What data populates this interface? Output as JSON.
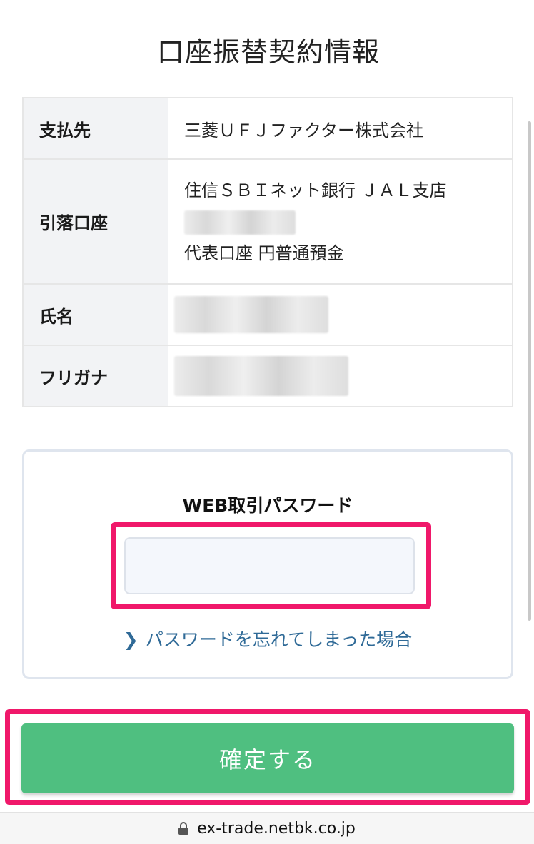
{
  "page": {
    "title": "口座振替契約情報"
  },
  "info_table": {
    "rows": [
      {
        "label": "支払先",
        "value": "三菱ＵＦＪファクター株式会社"
      },
      {
        "label": "引落口座",
        "bank": "住信ＳＢＩネット銀行 ＪＡＬ支店",
        "account_type": "代表口座 円普通預金"
      },
      {
        "label": "氏名"
      },
      {
        "label": "フリガナ"
      }
    ]
  },
  "password_section": {
    "label": "WEB取引パスワード",
    "input_value": "",
    "forgot_link": "パスワードを忘れてしまった場合"
  },
  "confirm_button": {
    "label": "確定する",
    "color": "#4fbf80"
  },
  "highlight_color": "#f0186a",
  "browser": {
    "url": "ex-trade.netbk.co.jp"
  }
}
